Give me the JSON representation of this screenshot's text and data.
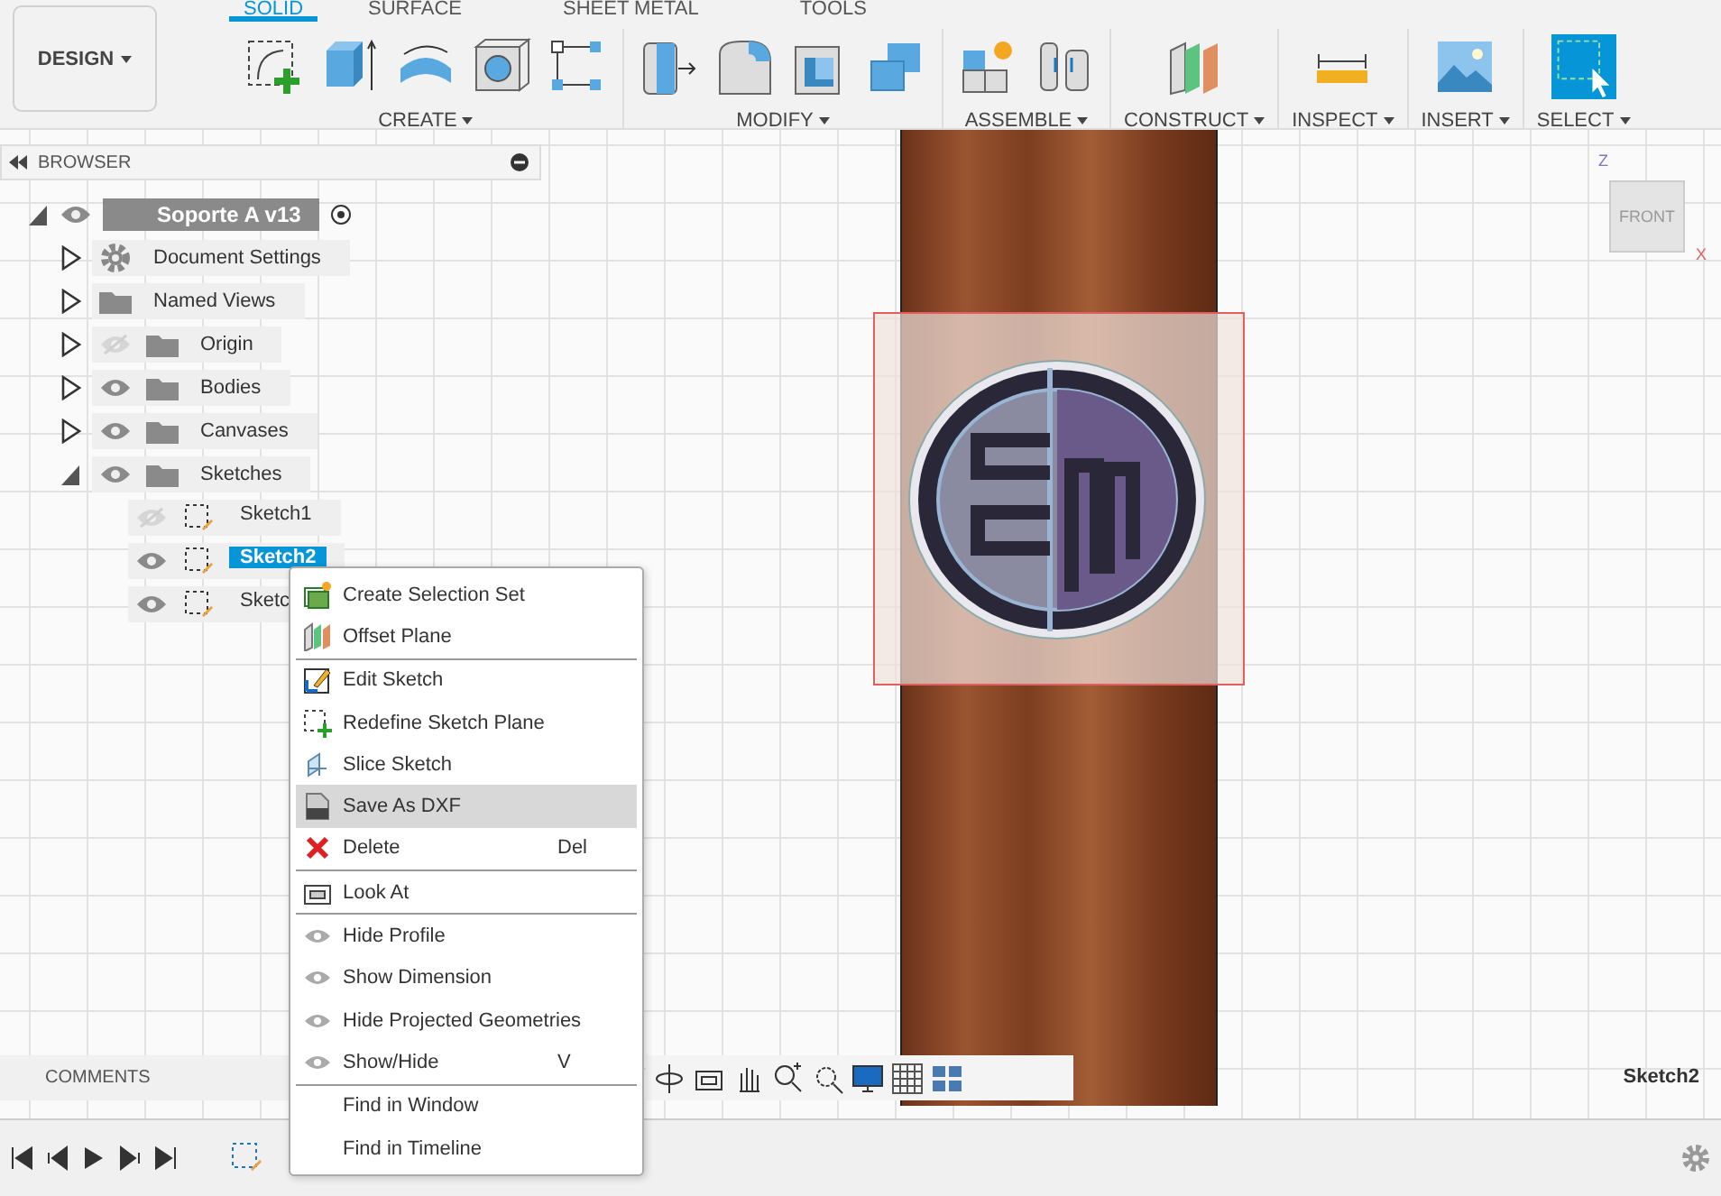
{
  "workspace_button": {
    "label": "DESIGN"
  },
  "tabs": [
    {
      "label": "SOLID",
      "selected": true
    },
    {
      "label": "SURFACE",
      "selected": false
    },
    {
      "label": "SHEET METAL",
      "selected": false
    },
    {
      "label": "TOOLS",
      "selected": false
    }
  ],
  "tool_groups": [
    {
      "label": "CREATE",
      "tools": [
        {
          "kind": "sketch"
        },
        {
          "kind": "extrude"
        },
        {
          "kind": "revolve"
        },
        {
          "kind": "hole"
        },
        {
          "kind": "pattern"
        }
      ]
    },
    {
      "label": "MODIFY",
      "tools": [
        {
          "kind": "presspull"
        },
        {
          "kind": "fillet"
        },
        {
          "kind": "shell"
        },
        {
          "kind": "combine"
        }
      ]
    },
    {
      "label": "ASSEMBLE",
      "tools": [
        {
          "kind": "component"
        },
        {
          "kind": "joint"
        }
      ]
    },
    {
      "label": "CONSTRUCT",
      "tools": [
        {
          "kind": "plane"
        }
      ]
    },
    {
      "label": "INSPECT",
      "tools": [
        {
          "kind": "measure"
        }
      ]
    },
    {
      "label": "INSERT",
      "tools": [
        {
          "kind": "image"
        }
      ]
    },
    {
      "label": "SELECT",
      "tools": [
        {
          "kind": "select"
        }
      ]
    }
  ],
  "browser": {
    "title": "BROWSER",
    "root": {
      "label": "Soporte A v13",
      "visible": true,
      "expanded": true,
      "children": [
        {
          "label": "Document Settings",
          "kind": "gear",
          "expanded": false
        },
        {
          "label": "Named Views",
          "kind": "folder",
          "expanded": false
        },
        {
          "label": "Origin",
          "kind": "folder",
          "visible": false,
          "expanded": false
        },
        {
          "label": "Bodies",
          "kind": "folder",
          "visible": true,
          "expanded": false
        },
        {
          "label": "Canvases",
          "kind": "folder",
          "visible": true,
          "expanded": false
        },
        {
          "label": "Sketches",
          "kind": "folder",
          "visible": true,
          "expanded": true,
          "children": [
            {
              "label": "Sketch1",
              "kind": "sketch",
              "visible": false,
              "selected": false
            },
            {
              "label": "Sketch2",
              "kind": "sketch",
              "visible": true,
              "selected": true
            },
            {
              "label": "Sketc",
              "kind": "sketch",
              "visible": true,
              "selected": false
            }
          ]
        }
      ]
    }
  },
  "context_menu": {
    "sections": [
      [
        {
          "label": "Create Selection Set",
          "kind": "selection-set",
          "selected": false
        },
        {
          "label": "Offset Plane",
          "kind": "plane",
          "selected": false
        }
      ],
      [
        {
          "label": "Edit Sketch",
          "kind": "edit-sketch",
          "selected": false
        },
        {
          "label": "Redefine Sketch Plane",
          "kind": "redefine",
          "selected": false
        },
        {
          "label": "Slice Sketch",
          "kind": "slice",
          "selected": false
        },
        {
          "label": "Save As DXF",
          "kind": "dxf",
          "selected": true
        },
        {
          "label": "Delete",
          "kind": "delete",
          "shortcut": "Del",
          "selected": false
        }
      ],
      [
        {
          "label": "Look At",
          "kind": "look-at",
          "selected": false
        }
      ],
      [
        {
          "label": "Hide Profile",
          "kind": "eye",
          "selected": false
        },
        {
          "label": "Show Dimension",
          "kind": "eye",
          "selected": false
        },
        {
          "label": "Hide Projected Geometries",
          "kind": "eye",
          "selected": false
        },
        {
          "label": "Show/Hide",
          "kind": "eye",
          "shortcut": "V",
          "selected": false
        }
      ],
      [
        {
          "label": "Find in Window",
          "kind": "plain",
          "selected": false
        },
        {
          "label": "Find in Timeline",
          "kind": "plain",
          "selected": false
        }
      ]
    ]
  },
  "view_cube": {
    "face": "FRONT",
    "axes": [
      "Z",
      "X"
    ]
  },
  "comments": {
    "title": "COMMENTS"
  },
  "status": "Sketch2"
}
